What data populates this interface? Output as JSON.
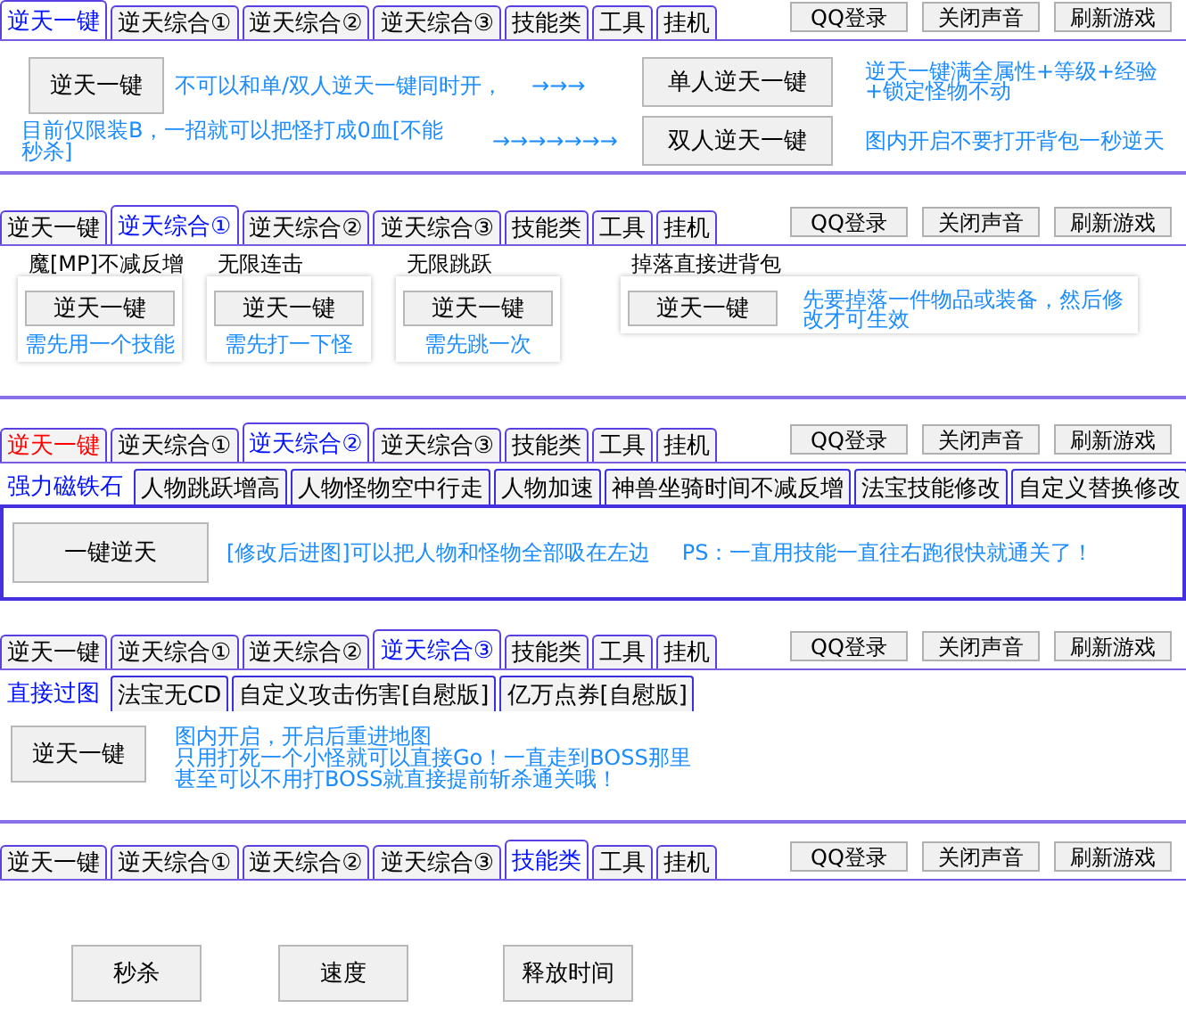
{
  "panels": [
    {
      "tabs": [
        {
          "label": "逆天一键",
          "selected": true
        },
        {
          "label": "逆天综合①",
          "selected": false
        },
        {
          "label": "逆天综合②",
          "selected": false
        },
        {
          "label": "逆天综合③",
          "selected": false
        },
        {
          "label": "技能类",
          "selected": false
        },
        {
          "label": "工具",
          "selected": false
        },
        {
          "label": "挂机",
          "selected": false
        }
      ],
      "header_buttons": [
        "QQ登录",
        "关闭声音",
        "刷新游戏"
      ],
      "body": {
        "kind": "one-click",
        "main_button": "逆天一键",
        "note_1": "不可以和单/双人逆天一键同时开，",
        "arrows_1": "→→→",
        "note_2": "目前仅限装B，一招就可以把怪打成0血[不能秒杀]",
        "arrows_2": "→→→→→→→",
        "buttons": [
          {
            "label": "单人逆天一键",
            "note": "逆天一键满全属性+等级+经验+锁定怪物不动"
          },
          {
            "label": "双人逆天一键",
            "note": "图内开启不要打开背包一秒逆天"
          }
        ]
      }
    },
    {
      "tabs": [
        {
          "label": "逆天一键",
          "selected": false
        },
        {
          "label": "逆天综合①",
          "selected": true
        },
        {
          "label": "逆天综合②",
          "selected": false
        },
        {
          "label": "逆天综合③",
          "selected": false
        },
        {
          "label": "技能类",
          "selected": false
        },
        {
          "label": "工具",
          "selected": false
        },
        {
          "label": "挂机",
          "selected": false
        }
      ],
      "header_buttons": [
        "QQ登录",
        "关闭声音",
        "刷新游戏"
      ],
      "body": {
        "kind": "groups",
        "groups": [
          {
            "title": "魔[MP]不减反增",
            "button": "逆天一键",
            "note": "需先用一个技能"
          },
          {
            "title": "无限连击",
            "button": "逆天一键",
            "note": "需先打一下怪"
          },
          {
            "title": "无限跳跃",
            "button": "逆天一键",
            "note": "需先跳一次"
          },
          {
            "title": "掉落直接进背包",
            "button": "逆天一键",
            "note": "先要掉落一件物品或装备，然后修改才可生效"
          }
        ]
      }
    },
    {
      "tabs": [
        {
          "label": "逆天一键",
          "selected": false,
          "red": true
        },
        {
          "label": "逆天综合①",
          "selected": false,
          "red": false
        },
        {
          "label": "逆天综合②",
          "selected": true,
          "red": false
        },
        {
          "label": "逆天综合③",
          "selected": false,
          "red": false
        },
        {
          "label": "技能类",
          "selected": false,
          "red": false
        },
        {
          "label": "工具",
          "selected": false,
          "red": false
        },
        {
          "label": "挂机",
          "selected": false,
          "red": false
        }
      ],
      "header_buttons": [
        "QQ登录",
        "关闭声音",
        "刷新游戏"
      ],
      "subtabs": [
        {
          "label": "强力磁铁石",
          "selected": true
        },
        {
          "label": "人物跳跃增高",
          "selected": false
        },
        {
          "label": "人物怪物空中行走",
          "selected": false
        },
        {
          "label": "人物加速",
          "selected": false
        },
        {
          "label": "神兽坐骑时间不减反增",
          "selected": false
        },
        {
          "label": "法宝技能修改",
          "selected": false
        },
        {
          "label": "自定义替换修改",
          "selected": false
        }
      ],
      "body": {
        "kind": "note-row",
        "button": "一键逆天",
        "notes": [
          "[修改后进图]可以把人物和怪物全部吸在左边",
          "PS：一直用技能一直往右跑很快就通关了！"
        ]
      }
    },
    {
      "tabs": [
        {
          "label": "逆天一键",
          "selected": false
        },
        {
          "label": "逆天综合①",
          "selected": false
        },
        {
          "label": "逆天综合②",
          "selected": false
        },
        {
          "label": "逆天综合③",
          "selected": true
        },
        {
          "label": "技能类",
          "selected": false
        },
        {
          "label": "工具",
          "selected": false
        },
        {
          "label": "挂机",
          "selected": false
        }
      ],
      "header_buttons": [
        "QQ登录",
        "关闭声音",
        "刷新游戏"
      ],
      "subtabs": [
        {
          "label": "直接过图",
          "selected": true
        },
        {
          "label": "法宝无CD",
          "selected": false
        },
        {
          "label": "自定义攻击伤害[自慰版]",
          "selected": false
        },
        {
          "label": "亿万点券[自慰版]",
          "selected": false
        }
      ],
      "body": {
        "kind": "note-lines",
        "button": "逆天一键",
        "lines": [
          "图内开启，开启后重进地图",
          "只用打死一个小怪就可以直接Go！一直走到BOSS那里",
          "甚至可以不用打BOSS就直接提前斩杀通关哦！"
        ]
      }
    },
    {
      "tabs": [
        {
          "label": "逆天一键",
          "selected": false
        },
        {
          "label": "逆天综合①",
          "selected": false
        },
        {
          "label": "逆天综合②",
          "selected": false
        },
        {
          "label": "逆天综合③",
          "selected": false
        },
        {
          "label": "技能类",
          "selected": true
        },
        {
          "label": "工具",
          "selected": false
        },
        {
          "label": "挂机",
          "selected": false
        }
      ],
      "header_buttons": [
        "QQ登录",
        "关闭声音",
        "刷新游戏"
      ],
      "body": {
        "kind": "buttons",
        "buttons": [
          "秒杀",
          "速度",
          "释放时间"
        ]
      }
    }
  ]
}
